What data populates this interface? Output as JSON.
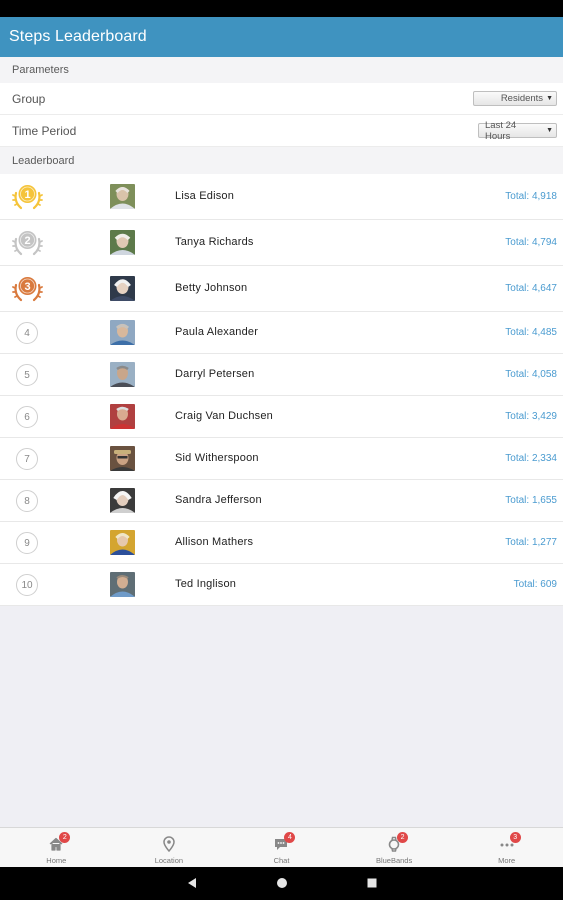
{
  "app": {
    "title": "Steps Leaderboard"
  },
  "sections": {
    "parameters": "Parameters",
    "leaderboard": "Leaderboard"
  },
  "params": [
    {
      "label": "Group",
      "value": "Residents"
    },
    {
      "label": "Time Period",
      "value": "Last 24 Hours"
    }
  ],
  "colors": {
    "accent": "#3f93c0",
    "gold": "#f5c43a",
    "silver": "#c4c4c4",
    "bronze": "#d97a3e",
    "total": "#4a9bd0",
    "badge": "#e04848"
  },
  "leaderboard": [
    {
      "rank": "1",
      "name": "Lisa Edison",
      "total": "Total: 4,918"
    },
    {
      "rank": "2",
      "name": "Tanya Richards",
      "total": "Total: 4,794"
    },
    {
      "rank": "3",
      "name": "Betty Johnson",
      "total": "Total: 4,647"
    },
    {
      "rank": "4",
      "name": "Paula Alexander",
      "total": "Total: 4,485"
    },
    {
      "rank": "5",
      "name": "Darryl Petersen",
      "total": "Total: 4,058"
    },
    {
      "rank": "6",
      "name": "Craig Van Duchsen",
      "total": "Total: 3,429"
    },
    {
      "rank": "7",
      "name": "Sid Witherspoon",
      "total": "Total: 2,334"
    },
    {
      "rank": "8",
      "name": "Sandra Jefferson",
      "total": "Total: 1,655"
    },
    {
      "rank": "9",
      "name": "Allison Mathers",
      "total": "Total: 1,277"
    },
    {
      "rank": "10",
      "name": "Ted Inglison",
      "total": "Total: 609"
    }
  ],
  "tabs": [
    {
      "label": "Home",
      "icon": "home-icon",
      "badge": "2"
    },
    {
      "label": "Location",
      "icon": "location-pin-icon",
      "badge": ""
    },
    {
      "label": "Chat",
      "icon": "chat-icon",
      "badge": "4"
    },
    {
      "label": "BlueBands",
      "icon": "bluebands-icon",
      "badge": "2"
    },
    {
      "label": "More",
      "icon": "more-icon",
      "badge": "3"
    }
  ],
  "system_nav": [
    {
      "icon": "back-icon"
    },
    {
      "icon": "home-circle-icon"
    },
    {
      "icon": "recents-icon"
    }
  ]
}
